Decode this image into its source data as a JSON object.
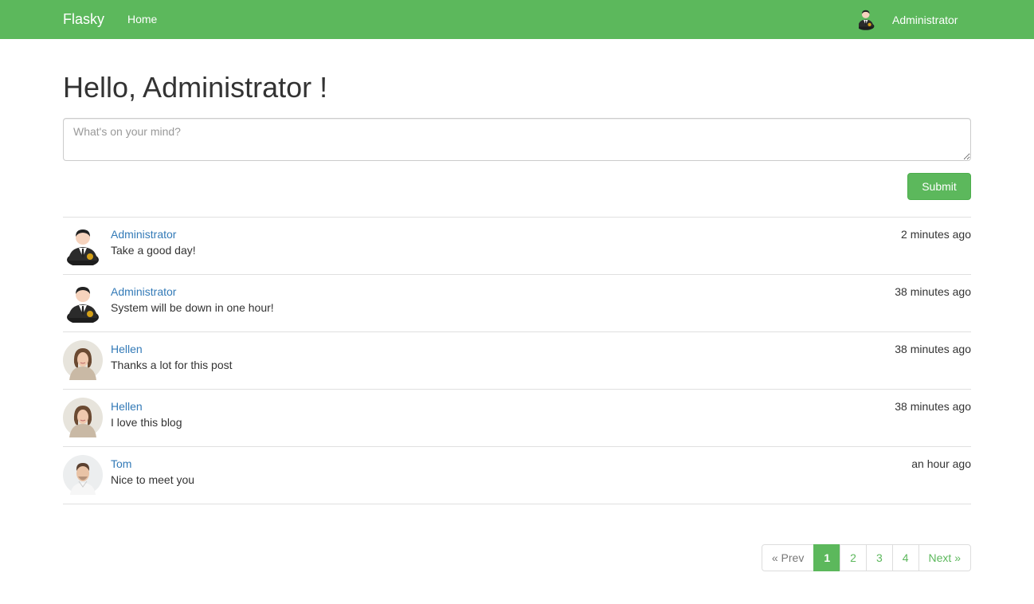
{
  "navbar": {
    "brand": "Flasky",
    "links": [
      {
        "label": "Home"
      }
    ],
    "user": {
      "name": "Administrator",
      "avatar_icon": "admin-avatar-icon"
    }
  },
  "main": {
    "title": "Hello, Administrator !",
    "post_form": {
      "placeholder": "What's on your mind?",
      "value": "",
      "submit_label": "Submit"
    }
  },
  "posts": [
    {
      "author": "Administrator",
      "avatar": "admin-avatar-icon",
      "body": "Take a good day!",
      "time": "2 minutes ago"
    },
    {
      "author": "Administrator",
      "avatar": "admin-avatar-icon",
      "body": "System will be down in one hour!",
      "time": "38 minutes ago"
    },
    {
      "author": "Hellen",
      "avatar": "female-avatar-icon",
      "body": "Thanks a lot for this post",
      "time": "38 minutes ago"
    },
    {
      "author": "Hellen",
      "avatar": "female-avatar-icon",
      "body": "I love this blog",
      "time": "38 minutes ago"
    },
    {
      "author": "Tom",
      "avatar": "male-avatar-icon",
      "body": "Nice to meet you",
      "time": "an hour ago"
    }
  ],
  "pagination": {
    "prev_label": "« Prev",
    "pages": [
      "1",
      "2",
      "3",
      "4"
    ],
    "active_page": "1",
    "next_label": "Next »"
  },
  "colors": {
    "primary": "#5cb85c",
    "link": "#337ab7",
    "text": "#333333",
    "border": "#e0e0e0"
  }
}
